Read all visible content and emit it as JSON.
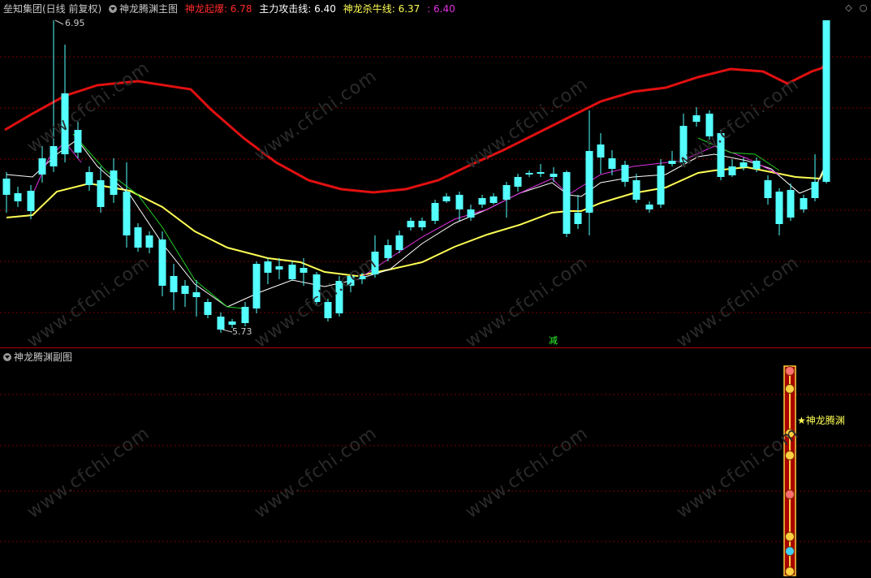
{
  "main": {
    "stock_name": "垒知集团(日线 前复权)",
    "indicator_name": "神龙腾渊主图",
    "lines": [
      {
        "label": "神龙起爆:",
        "value": "6.78",
        "color": "#ff2a2a"
      },
      {
        "label": "主力攻击线:",
        "value": "6.40",
        "color": "#ffffff"
      },
      {
        "label": "神龙杀牛线:",
        "value": "6.37",
        "color": "#ffff55"
      },
      {
        "label": ":",
        "value": "6.40",
        "color": "#e030e0"
      }
    ],
    "high_label": "6.95",
    "low_label": "5.73",
    "signal_label": "减",
    "toolbar": {
      "diamond_icon": "diamond-icon",
      "circle_icon": "circle-icon"
    }
  },
  "sub": {
    "indicator_name": "神龙腾渊副图",
    "marker_label": "★神龙腾渊"
  },
  "watermark": "www.cfchi.com",
  "colors": {
    "bull": "#ff3030",
    "bear": "#54ffff",
    "red_band": "#e01010",
    "ma_yellow": "#ffff55",
    "ma_white": "#ffffff",
    "ma_magenta": "#e030e0",
    "ma_green": "#20d020",
    "grid": "#7a0000"
  }
}
